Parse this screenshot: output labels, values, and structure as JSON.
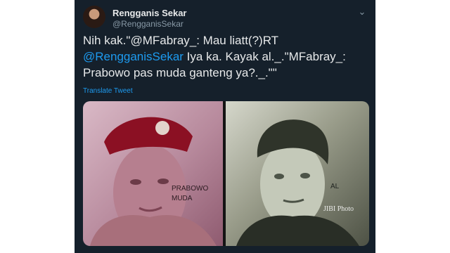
{
  "author": {
    "name": "Rengganis Sekar",
    "handle": "@RengganisSekar"
  },
  "tweet": {
    "part1": "Nih kak.\"@MFabray_: Mau liatt(?)RT ",
    "mention": "@RengganisSekar",
    "part2": " Iya ka. Kayak al._.\"MFabray_: Prabowo pas muda ganteng ya?._.\"\""
  },
  "translate_label": "Translate Tweet",
  "media": {
    "left_caption_line1": "PRABOWO",
    "left_caption_line2": "MUDA",
    "right_caption": "AL",
    "watermark": "JIBI Photo"
  },
  "icons": {
    "menu": "chevron-down-icon"
  },
  "colors": {
    "background": "#15202b",
    "link": "#1d9bf0"
  }
}
